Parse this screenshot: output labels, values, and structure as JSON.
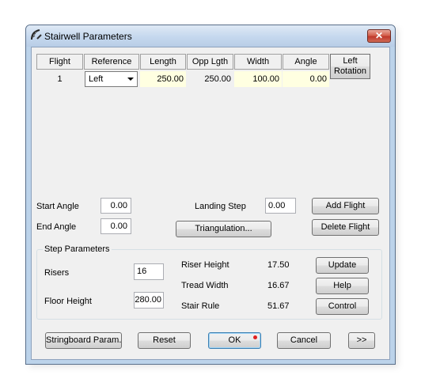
{
  "window": {
    "title": "Stairwell Parameters",
    "close_label": "✕"
  },
  "flights_table": {
    "headers": [
      "Flight",
      "Reference",
      "Length",
      "Opp Lgth",
      "Width",
      "Angle"
    ],
    "left_rotation_button": "Left\nRotation",
    "rows": [
      {
        "flight": "1",
        "reference": "Left",
        "length": "250.00",
        "opp_lgth": "250.00",
        "width": "100.00",
        "angle": "0.00"
      }
    ]
  },
  "angles": {
    "start_angle_label": "Start Angle",
    "start_angle_value": "0.00",
    "end_angle_label": "End Angle",
    "end_angle_value": "0.00",
    "landing_step_label": "Landing Step",
    "landing_step_value": "0.00"
  },
  "buttons": {
    "add_flight": "Add Flight",
    "delete_flight": "Delete Flight",
    "triangulation": "Triangulation...",
    "update": "Update",
    "help": "Help",
    "control": "Control",
    "stringboard": "Stringboard Param.",
    "reset": "Reset",
    "ok": "OK",
    "cancel": "Cancel",
    "more": ">>"
  },
  "step_parameters": {
    "title": "Step Parameters",
    "risers_label": "Risers",
    "risers_value": "16",
    "floor_height_label": "Floor Height",
    "floor_height_value": "280.00",
    "riser_height_label": "Riser Height",
    "riser_height_value": "17.50",
    "tread_width_label": "Tread Width",
    "tread_width_value": "16.67",
    "stair_rule_label": "Stair Rule",
    "stair_rule_value": "51.67"
  }
}
